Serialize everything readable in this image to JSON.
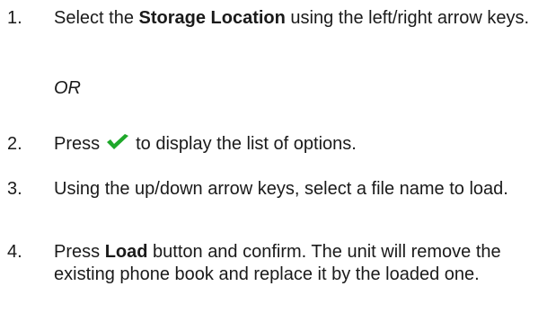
{
  "steps": [
    {
      "number": "1.",
      "before": "Select the ",
      "bold": "Storage Location",
      "after": " using the left/right arrow keys."
    },
    {
      "number": "2.",
      "before": "Press",
      "icon": "green-checkmark-icon",
      "after": "to display the list of options."
    },
    {
      "number": "3.",
      "text": "Using the up/down arrow keys, select a file name to load."
    },
    {
      "number": "4.",
      "before": "Press ",
      "bold": "Load",
      "after": " button and confirm. The unit will remove the existing phone book and replace it by the loaded one."
    }
  ],
  "or_label": "OR",
  "colors": {
    "text": "#1a1a1a",
    "check": "#1ea82a"
  }
}
